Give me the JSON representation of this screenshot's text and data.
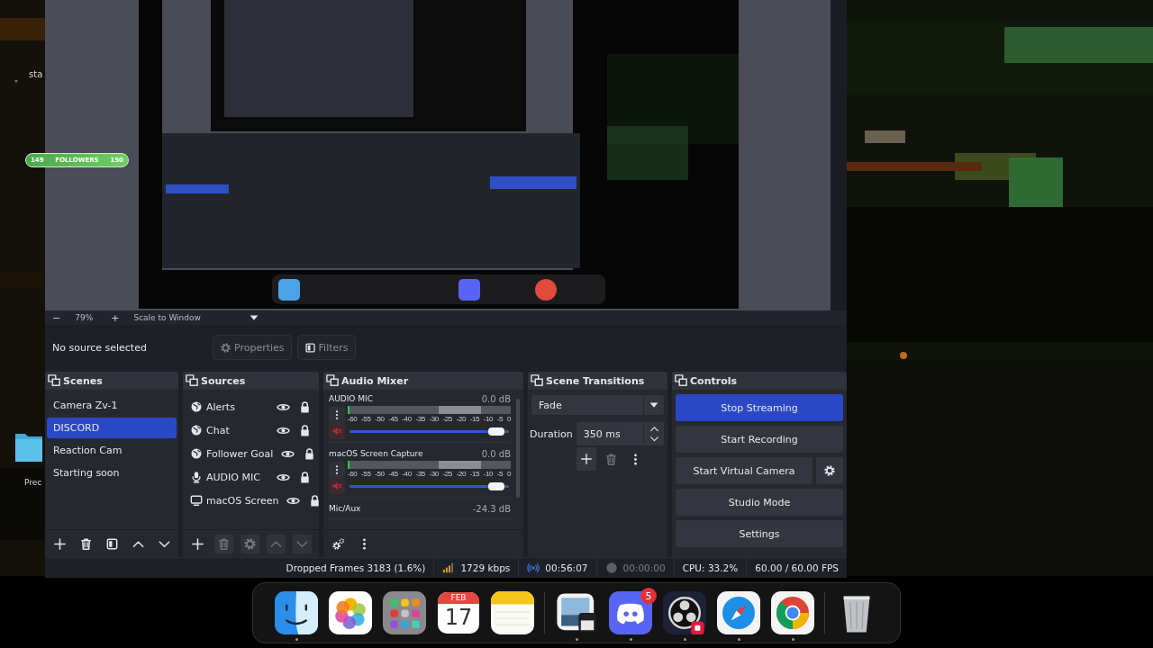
{
  "desktop": {
    "items": [
      {
        "kind": "text",
        "label": "sta"
      },
      {
        "kind": "folder",
        "label": "Prec"
      }
    ],
    "followers_widget": {
      "start": "149",
      "label": "FOLLOWERS",
      "end": "150"
    }
  },
  "preview_toolbar": {
    "minus": "−",
    "zoom": "79%",
    "plus": "+",
    "scale": "Scale to Window"
  },
  "source_bar": {
    "text": "No source selected",
    "buttons": [
      {
        "kind": "properties",
        "label": "Properties"
      },
      {
        "kind": "filters",
        "label": "Filters"
      }
    ]
  },
  "scenes": {
    "title": "Scenes",
    "items": [
      {
        "label": "Camera Zv-1",
        "selected": false
      },
      {
        "label": "DISCORD",
        "selected": true
      },
      {
        "label": "Reaction Cam",
        "selected": false
      },
      {
        "label": "Starting soon",
        "selected": false
      }
    ]
  },
  "sources": {
    "title": "Sources",
    "items": [
      {
        "kind": "browser",
        "label": "Alerts",
        "visible": true,
        "locked": true
      },
      {
        "kind": "browser",
        "label": "Chat",
        "visible": true,
        "locked": true
      },
      {
        "kind": "browser",
        "label": "Follower Goal",
        "visible": true,
        "locked": true
      },
      {
        "kind": "mic",
        "label": "AUDIO MIC",
        "visible": true,
        "locked": true
      },
      {
        "kind": "display",
        "label": "macOS Screen",
        "visible": true,
        "locked": true
      }
    ]
  },
  "audio_mixer": {
    "title": "Audio Mixer",
    "channels": [
      {
        "name": "AUDIO MIC",
        "reading": "0.0 dB",
        "muted": true,
        "level": 0.97,
        "scale": [
          "-60",
          "-55",
          "-50",
          "-45",
          "-40",
          "-35",
          "-30",
          "-25",
          "-20",
          "-15",
          "-10",
          "-5",
          "0"
        ]
      },
      {
        "name": "macOS Screen Capture",
        "reading": "0.0 dB",
        "muted": true,
        "level": 0.97,
        "scale": [
          "-60",
          "-55",
          "-50",
          "-45",
          "-40",
          "-35",
          "-30",
          "-25",
          "-20",
          "-15",
          "-10",
          "-5",
          "0"
        ]
      },
      {
        "name": "Mic/Aux",
        "reading": "-24.3 dB"
      }
    ]
  },
  "scene_transitions": {
    "title": "Scene Transitions",
    "transition": "Fade",
    "duration_label": "Duration",
    "duration": "350 ms"
  },
  "controls": {
    "title": "Controls",
    "buttons": [
      {
        "label": "Stop Streaming",
        "active": true,
        "settings": false
      },
      {
        "label": "Start Recording",
        "active": false,
        "settings": false
      },
      {
        "label": "Start Virtual Camera",
        "active": false,
        "settings": true
      },
      {
        "label": "Studio Mode",
        "active": false,
        "settings": false
      },
      {
        "label": "Settings",
        "active": false,
        "settings": false
      }
    ]
  },
  "status_bar": {
    "dropped_frames": "Dropped Frames 3183 (1.6%)",
    "bitrate": "1729 kbps",
    "stream_time": "00:56:07",
    "record_time": "00:00:00",
    "cpu": "CPU: 33.2%",
    "fps": "60.00 / 60.00 FPS"
  },
  "dock": {
    "apps": [
      {
        "kind": "finder",
        "running": true
      },
      {
        "kind": "photos",
        "running": false
      },
      {
        "kind": "launchpad",
        "running": false
      },
      {
        "kind": "calendar",
        "month": "FEB",
        "day": "17",
        "running": false
      },
      {
        "kind": "notes",
        "running": false
      },
      {
        "kind": "separator"
      },
      {
        "kind": "preview",
        "running": true
      },
      {
        "kind": "discord",
        "badge": "5",
        "running": true
      },
      {
        "kind": "obs",
        "running": true
      },
      {
        "kind": "safari",
        "running": true
      },
      {
        "kind": "chrome",
        "running": true
      },
      {
        "kind": "separator"
      },
      {
        "kind": "trash",
        "running": false
      }
    ]
  }
}
